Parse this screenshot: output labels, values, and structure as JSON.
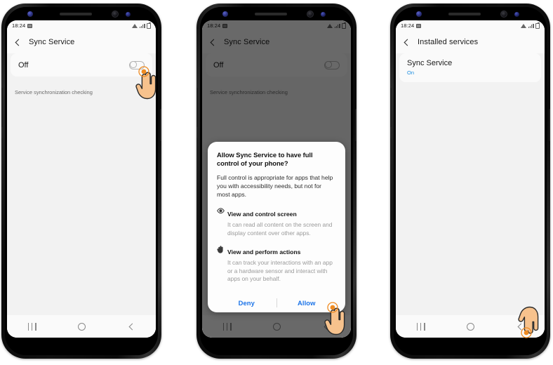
{
  "meta": {
    "app": "Android Accessibility Settings",
    "panel_count": 3
  },
  "status_bar": {
    "time": "18:24",
    "icons": [
      "image-icon",
      "wifi-icon",
      "signal-icon",
      "battery-icon"
    ]
  },
  "navigation_bar": {
    "recents_label": "|||",
    "home_label": "O",
    "back_label": "<",
    "icons": [
      "recents-icon",
      "home-icon",
      "back-icon"
    ]
  },
  "panel1": {
    "title": "Sync Service",
    "back_icon": "back-chevron-icon",
    "toggle_label": "Off",
    "toggle_state": "off",
    "helper_text": "Service synchronization checking",
    "cursor": "tap-hand-cursor"
  },
  "panel2": {
    "title": "Sync Service",
    "back_icon": "back-chevron-icon",
    "toggle_label": "Off",
    "toggle_state": "off",
    "helper_text": "Service synchronization checking",
    "dialog": {
      "title": "Allow Sync Service to have full control of your phone?",
      "body": "Full control is appropriate for apps that help you with accessibility needs, but not for most apps.",
      "permissions": [
        {
          "icon": "eye-icon",
          "heading": "View and control screen",
          "description": "It can read all content on the screen and display content over other apps."
        },
        {
          "icon": "hand-icon",
          "heading": "View and perform actions",
          "description": "It can track your interactions with an app or a hardware sensor and interact with apps on your behalf."
        }
      ],
      "deny_label": "Deny",
      "allow_label": "Allow",
      "button_color": "#1a73e8"
    },
    "cursor": "tap-hand-cursor"
  },
  "panel3": {
    "title": "Installed services",
    "back_icon": "back-chevron-icon",
    "service": {
      "name": "Sync Service",
      "state": "On",
      "state_color": "#1a8ce0"
    },
    "cursor": "tap-hand-cursor"
  },
  "colors": {
    "screen_bg": "#f2f2f2",
    "card_bg": "#fafafa",
    "accent_blue": "#1a73e8",
    "state_blue": "#1a8ce0",
    "muted_text": "#9a9a9a",
    "phone_body": "#111111",
    "cursor_skin": "#f5c08a",
    "ripple": "#ef8b22"
  }
}
